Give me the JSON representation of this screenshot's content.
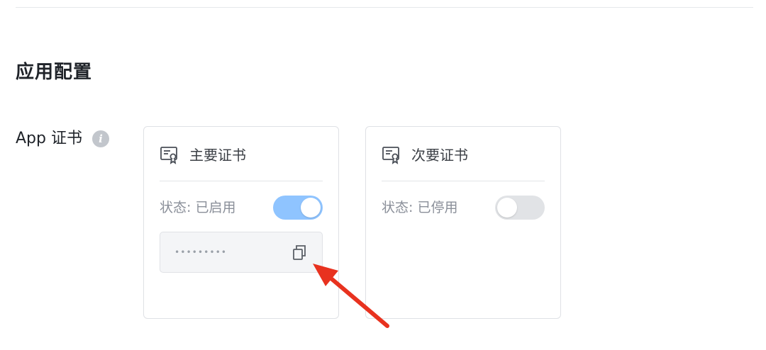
{
  "section": {
    "title": "应用配置"
  },
  "field": {
    "label": "App 证书",
    "info_icon": "info-icon",
    "info_glyph": "i"
  },
  "primary_cert": {
    "title": "主要证书",
    "icon": "certificate-icon",
    "status_text": "状态: 已启用",
    "enabled": true,
    "secret_masked": "•••••••••",
    "copy_icon": "copy-icon"
  },
  "secondary_cert": {
    "title": "次要证书",
    "icon": "certificate-icon",
    "status_text": "状态: 已停用",
    "enabled": false
  },
  "colors": {
    "toggle_on": "#8fc4ff",
    "toggle_off": "#e1e3e6",
    "annotation_arrow": "#e8321f"
  }
}
